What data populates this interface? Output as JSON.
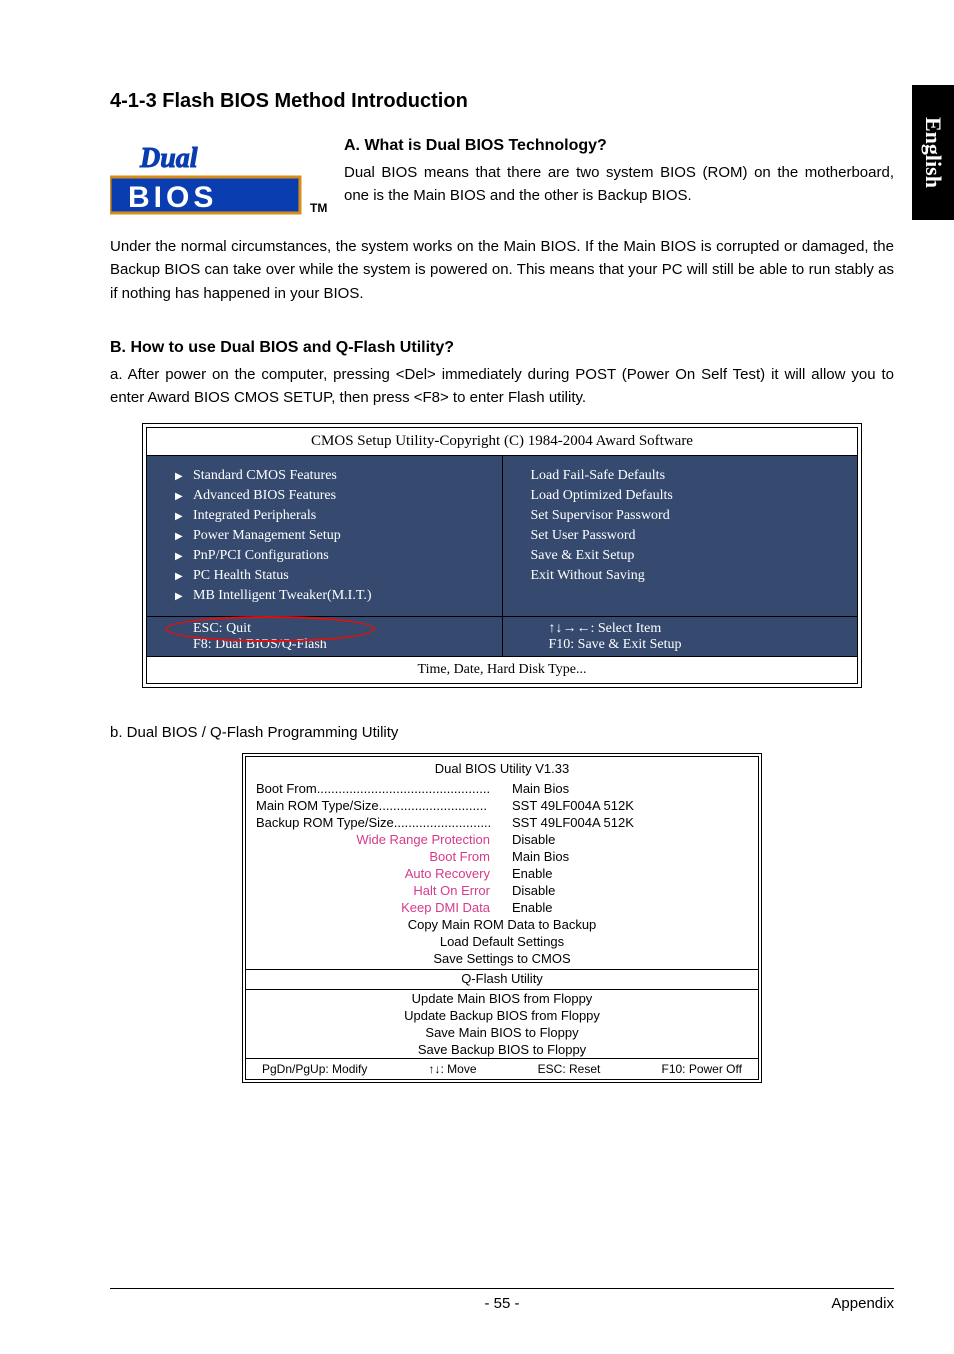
{
  "side_tab": "English",
  "heading": "4-1-3  Flash BIOS Method Introduction",
  "subA_title": "A.   What is Dual BIOS Technology?",
  "subA_p1": "Dual BIOS means that there are two system BIOS (ROM) on the motherboard, one is the Main BIOS and the other is Backup BIOS.",
  "subA_p2": "Under the normal circumstances, the system works on the Main BIOS. If the Main BIOS is corrupted or damaged, the Backup BIOS can take over while the system is powered on. This means that your PC will still be able to run stably as if nothing has happened in your BIOS.",
  "subB_title": "B.   How to use Dual BIOS and Q-Flash Utility?",
  "subB_p1": "a. After power on the computer, pressing <Del> immediately during POST (Power On Self Test) it will allow you to enter Award BIOS CMOS SETUP, then press <F8> to enter Flash utility.",
  "cmos": {
    "title": "CMOS Setup Utility-Copyright (C) 1984-2004 Award Software",
    "left": [
      "Standard CMOS Features",
      "Advanced BIOS Features",
      "Integrated Peripherals",
      "Power Management Setup",
      "PnP/PCI Configurations",
      "PC Health Status",
      "MB Intelligent Tweaker(M.I.T.)"
    ],
    "right": [
      "Load Fail-Safe Defaults",
      "Load Optimized Defaults",
      "Set Supervisor Password",
      "Set User Password",
      "Save & Exit Setup",
      "Exit Without Saving"
    ],
    "bl1": "ESC: Quit",
    "bl2": "F8: Dual BIOS/Q-Flash",
    "br1": "↑↓→←: Select Item",
    "br2": "F10: Save & Exit Setup",
    "help": "Time, Date, Hard Disk Type..."
  },
  "b_caption": "b.   Dual BIOS / Q-Flash Programming Utility",
  "qflash": {
    "title": "Dual BIOS Utility V1.33",
    "info": [
      {
        "lbl": "Boot From",
        "dots": "................................................",
        "val": "Main Bios"
      },
      {
        "lbl": "Main ROM Type/Size",
        "dots": "..............................",
        "val": "SST 49LF004A    512K"
      },
      {
        "lbl": "Backup ROM Type/Size",
        "dots": "...........................",
        "val": "SST 49LF004A    512K"
      }
    ],
    "config": [
      {
        "lbl": "Wide Range Protection",
        "val": "Disable"
      },
      {
        "lbl": "Boot From",
        "val": "Main Bios"
      },
      {
        "lbl": "Auto Recovery",
        "val": "Enable"
      },
      {
        "lbl": "Halt On Error",
        "val": "Disable"
      },
      {
        "lbl": "Keep DMI Data",
        "val": "Enable"
      }
    ],
    "actions1": [
      "Copy Main ROM Data to Backup",
      "Load Default Settings",
      "Save Settings to CMOS"
    ],
    "mid": "Q-Flash Utility",
    "actions2": [
      "Update Main BIOS from Floppy",
      "Update Backup BIOS from Floppy",
      "Save Main BIOS to Floppy",
      "Save Backup BIOS to Floppy"
    ],
    "bottom": [
      "PgDn/PgUp: Modify",
      "↑↓: Move",
      "ESC: Reset",
      "F10: Power Off"
    ]
  },
  "footer": {
    "page": "- 55 -",
    "section": "Appendix"
  }
}
